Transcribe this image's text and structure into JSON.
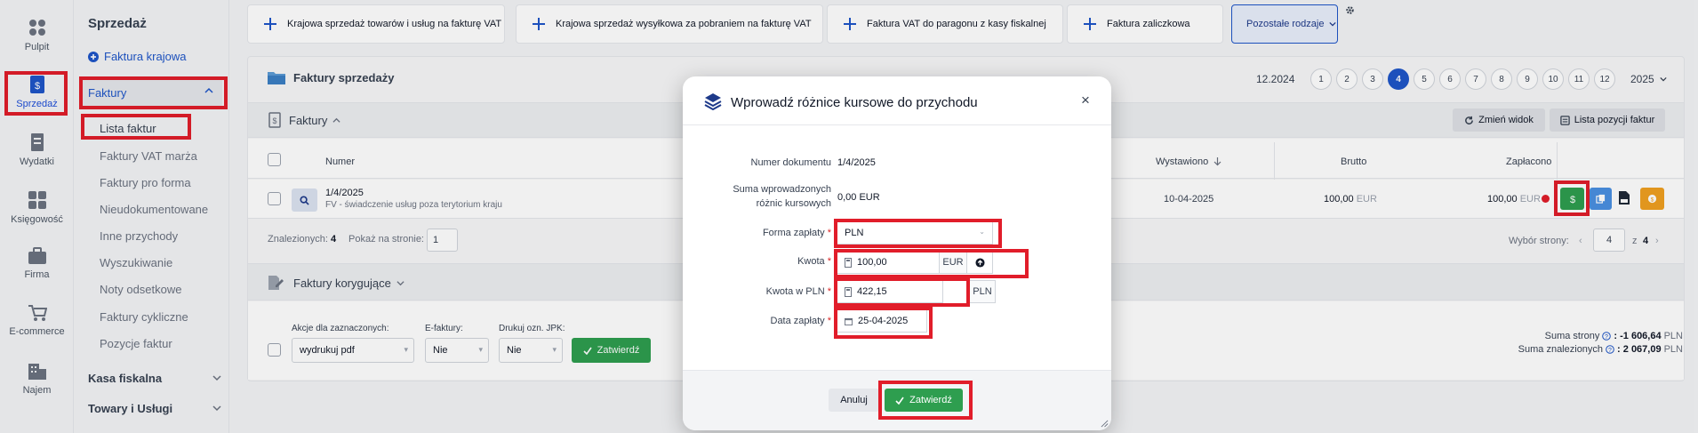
{
  "rail": {
    "items": [
      {
        "label": "Pulpit"
      },
      {
        "label": "Sprzedaż"
      },
      {
        "label": "Wydatki"
      },
      {
        "label": "Księgowość"
      },
      {
        "label": "Firma"
      },
      {
        "label": "E-commerce"
      },
      {
        "label": "Najem"
      }
    ]
  },
  "submenu": {
    "title": "Sprzedaż",
    "new_invoice": "Faktura krajowa",
    "section_invoices": "Faktury",
    "items": [
      "Lista faktur",
      "Faktury VAT marża",
      "Faktury pro forma",
      "Nieudokumentowane",
      "Inne przychody",
      "Wyszukiwanie",
      "Noty odsetkowe",
      "Faktury cykliczne",
      "Pozycje faktur"
    ],
    "section_cash": "Kasa fiskalna",
    "section_goods": "Towary i Usługi"
  },
  "toolbar": {
    "buttons": [
      "Krajowa sprzedaż towarów i usług na fakturę VAT",
      "Krajowa sprzedaż wysyłkowa za pobraniem na fakturę VAT",
      "Faktura VAT do paragonu z kasy fiskalnej",
      "Faktura zaliczkowa"
    ],
    "other_types": "Pozostałe rodzaje"
  },
  "sales_panel": {
    "title": "Faktury sprzedaży",
    "period": "12.2024",
    "months": [
      "1",
      "2",
      "3",
      "4",
      "5",
      "6",
      "7",
      "8",
      "9",
      "10",
      "11",
      "12"
    ],
    "active_month": "4",
    "year": "2025"
  },
  "invoices": {
    "title": "Faktury",
    "change_view": "Zmień widok",
    "positions_list": "Lista pozycji faktur",
    "columns": {
      "number": "Numer",
      "issued": "Wystawiono",
      "gross": "Brutto",
      "paid": "Zapłacono"
    },
    "row": {
      "number": "1/4/2025",
      "description": "FV - świadczenie usług poza terytorium kraju",
      "issued": "10-04-2025",
      "gross": "100,00",
      "gross_currency": "EUR",
      "paid": "100,00",
      "paid_currency": "EUR"
    },
    "found_label": "Znalezionych:",
    "found_count": "4",
    "per_page_label": "Pokaż na stronie:",
    "per_page_value": "1",
    "page_select_label": "Wybór strony:",
    "page_current": "4",
    "page_of": "z",
    "page_total": "4"
  },
  "corrections": {
    "title": "Faktury korygujące",
    "actions_label": "Akcje dla zaznaczonych:",
    "actions_value": "wydrukuj pdf",
    "einvoice_label": "E-faktury:",
    "einvoice_value": "Nie",
    "jpk_label": "Drukuj ozn. JPK:",
    "jpk_value": "Nie",
    "confirm": "Zatwierdź",
    "page_sum_label": "Suma strony",
    "page_sum_value": ": -1 606,64",
    "found_sum_label": "Suma znalezionych",
    "found_sum_value": ": 2 067,09",
    "currency": "PLN"
  },
  "modal": {
    "title": "Wprowadź różnice kursowe do przychodu",
    "doc_number_label": "Numer dokumentu",
    "doc_number_value": "1/4/2025",
    "sum_label_1": "Suma wprowadzonych",
    "sum_label_2": "różnic kursowych",
    "sum_value": "0,00 EUR",
    "payment_form_label": "Forma zapłaty",
    "payment_form_value": "PLN",
    "amount_label": "Kwota",
    "amount_value": "100,00",
    "amount_currency": "EUR",
    "amount_pln_label": "Kwota w PLN",
    "amount_pln_value": "422,15",
    "amount_pln_currency": "PLN",
    "payment_date_label": "Data zapłaty",
    "payment_date_value": "25-04-2025",
    "cancel": "Anuluj",
    "confirm": "Zatwierdź",
    "required_mark": "*"
  },
  "colors": {
    "accent": "#1e56c8",
    "success": "#2e9e4f",
    "highlight": "#e11d2a",
    "warning": "#f0a020",
    "info": "#4a90e2"
  }
}
